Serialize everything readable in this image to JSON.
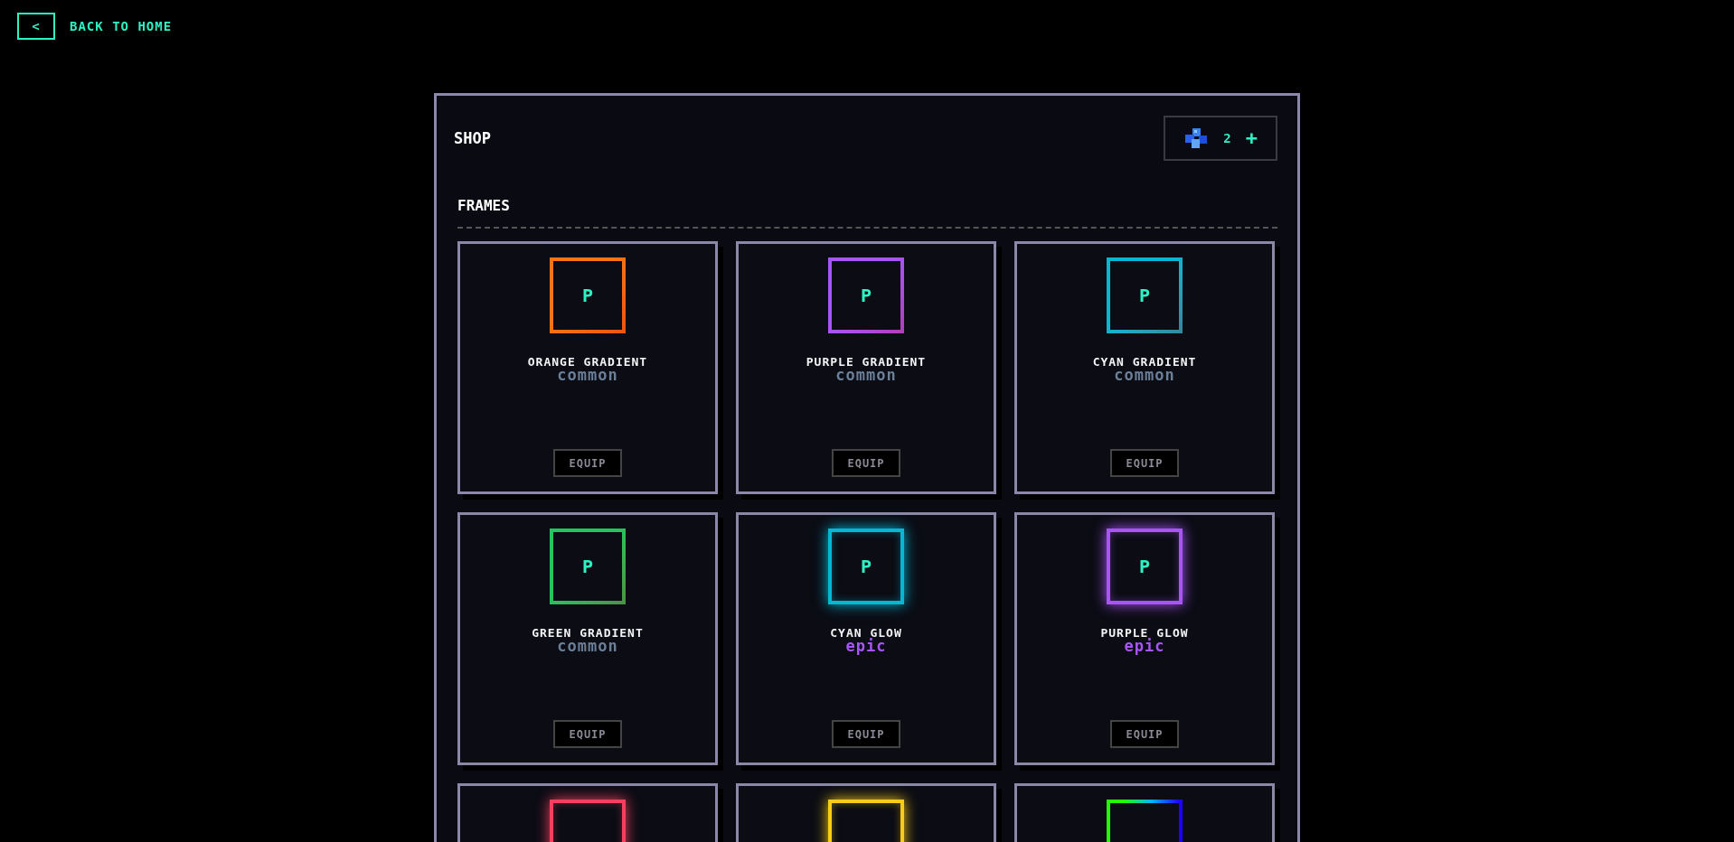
{
  "back_link": {
    "icon": "<",
    "label": "BACK TO HOME"
  },
  "shop": {
    "title": "SHOP",
    "currency": {
      "amount": "2",
      "add": "+"
    },
    "sections": [
      {
        "title": "FRAMES",
        "items": [
          {
            "avatar": "P",
            "name": "ORANGE GRADIENT",
            "rarity": {
              "label": "common",
              "color": "#6b7f99"
            },
            "kind": "gradient",
            "color": "#f97316",
            "button": "EQUIP"
          },
          {
            "avatar": "P",
            "name": "PURPLE GRADIENT",
            "rarity": {
              "label": "common",
              "color": "#6b7f99"
            },
            "kind": "gradient",
            "color": "#a855f7",
            "button": "EQUIP"
          },
          {
            "avatar": "P",
            "name": "CYAN GRADIENT",
            "rarity": {
              "label": "common",
              "color": "#6b7f99"
            },
            "kind": "gradient",
            "color": "#06b6d4",
            "button": "EQUIP"
          },
          {
            "avatar": "P",
            "name": "GREEN GRADIENT",
            "rarity": {
              "label": "common",
              "color": "#6b7f99"
            },
            "kind": "gradient",
            "color": "#22c55e",
            "button": "EQUIP"
          },
          {
            "avatar": "P",
            "name": "CYAN GLOW",
            "rarity": {
              "label": "epic",
              "color": "#a855f7"
            },
            "kind": "glow",
            "color": "#06b6d4",
            "button": "EQUIP"
          },
          {
            "avatar": "P",
            "name": "PURPLE GLOW",
            "rarity": {
              "label": "epic",
              "color": "#a855f7"
            },
            "kind": "glow",
            "color": "#a855f7",
            "button": "EQUIP"
          },
          {
            "kind": "glow",
            "color": "#f43f5e"
          },
          {
            "kind": "glow",
            "color": "#facc15"
          },
          {
            "kind": "rainbow",
            "color": "#22ff00"
          }
        ]
      }
    ]
  }
}
